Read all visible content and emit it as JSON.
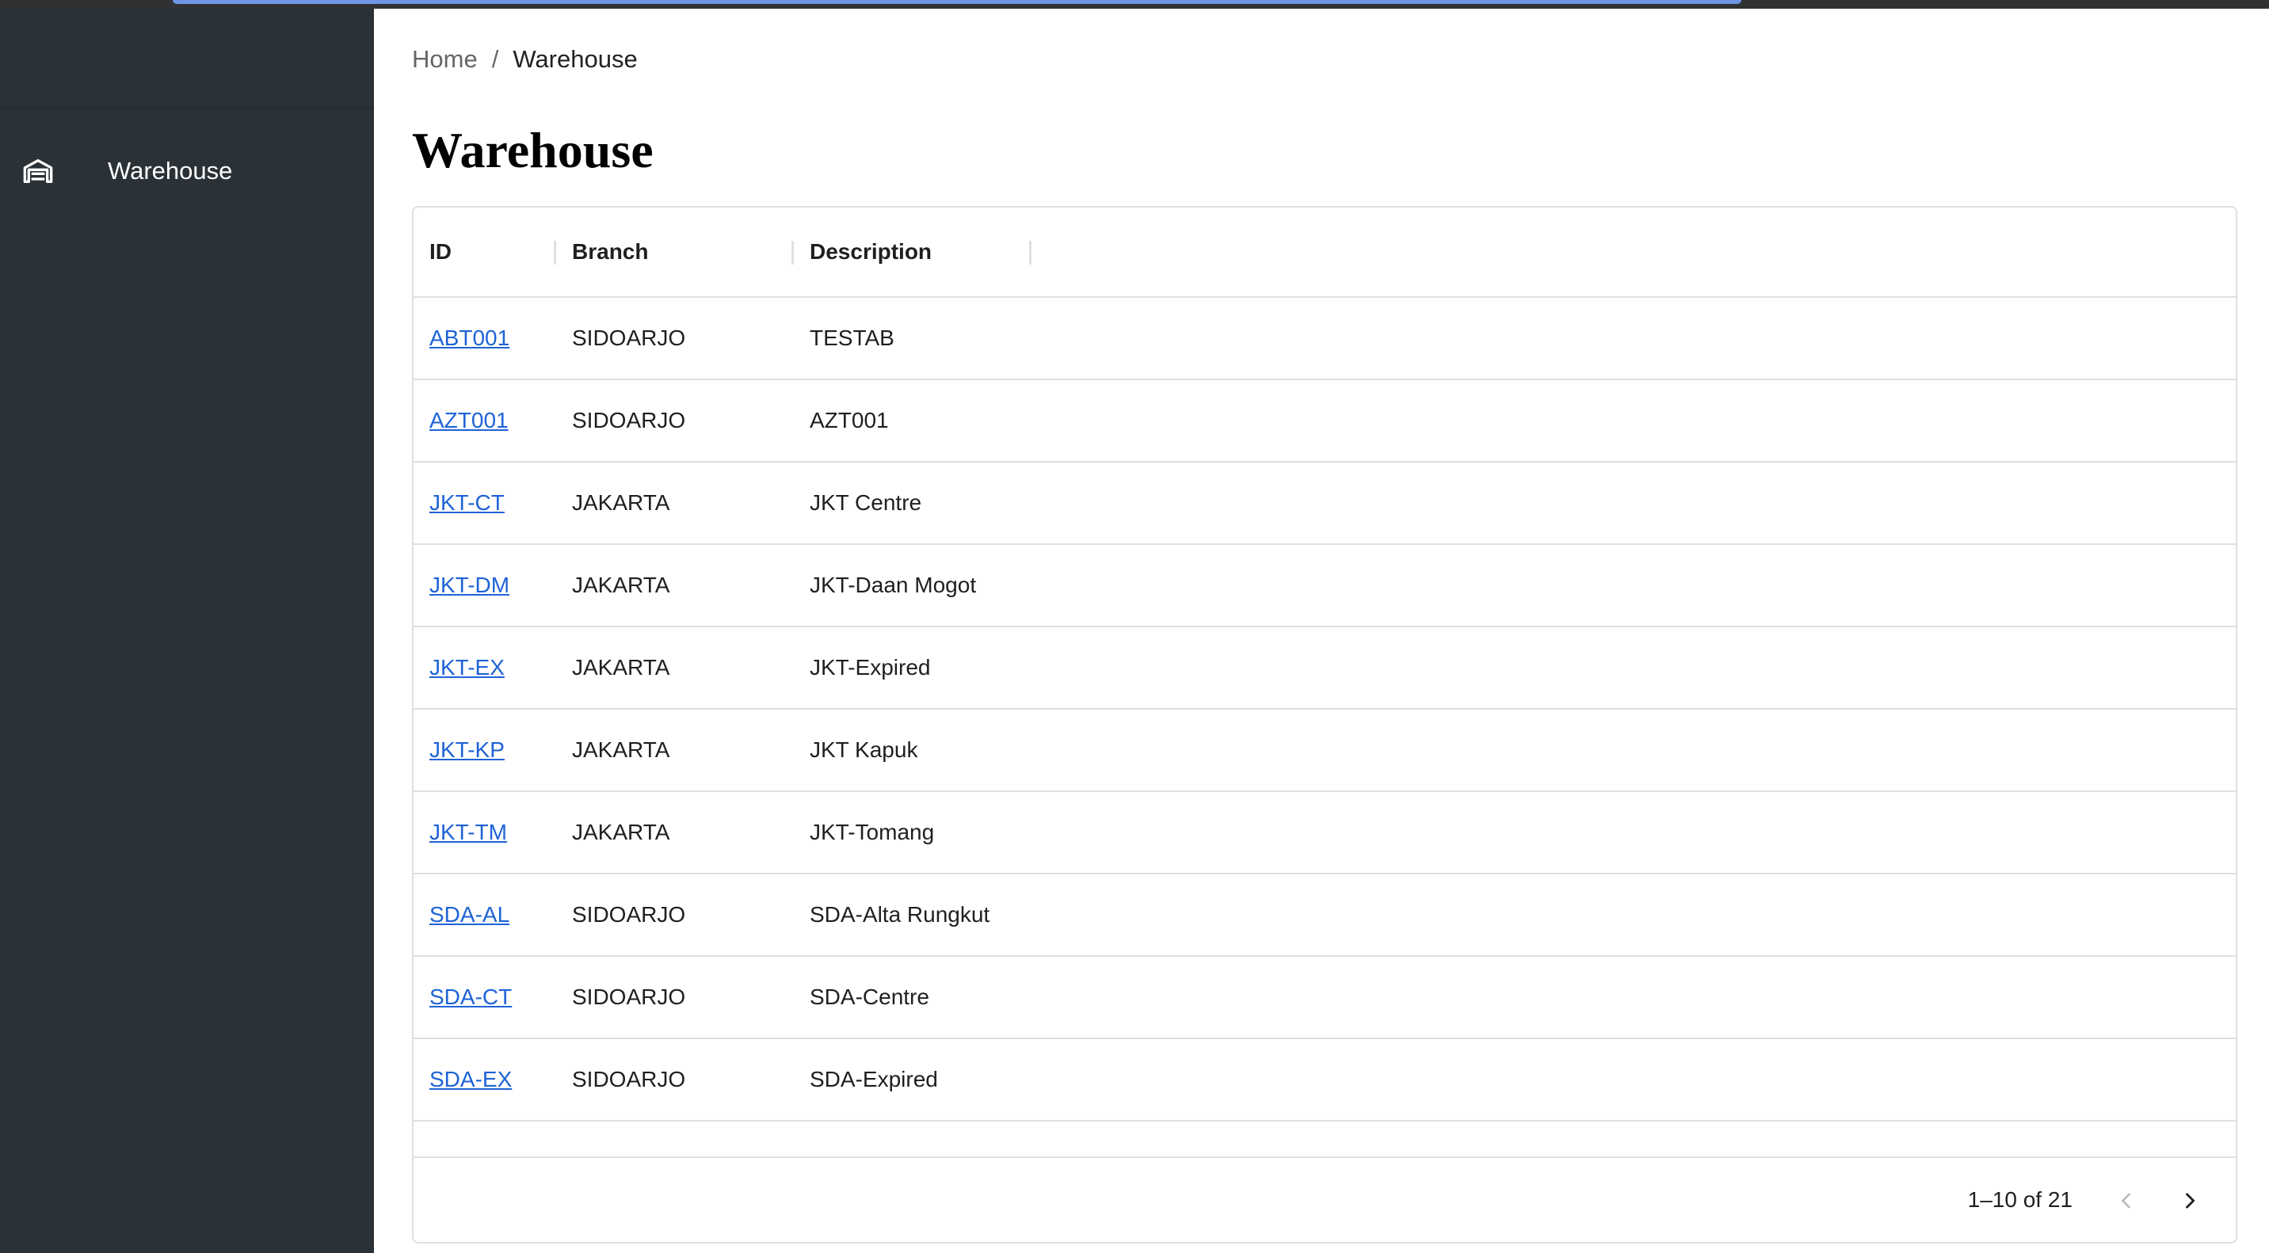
{
  "sidebar": {
    "items": [
      {
        "label": "Warehouse",
        "icon": "warehouse-icon"
      }
    ]
  },
  "breadcrumb": {
    "home": "Home",
    "separator": "/",
    "current": "Warehouse"
  },
  "page": {
    "title": "Warehouse"
  },
  "table": {
    "columns": [
      "ID",
      "Branch",
      "Description"
    ],
    "rows": [
      {
        "id": "ABT001",
        "branch": "SIDOARJO",
        "description": "TESTAB"
      },
      {
        "id": "AZT001",
        "branch": "SIDOARJO",
        "description": "AZT001"
      },
      {
        "id": "JKT-CT",
        "branch": "JAKARTA",
        "description": "JKT Centre"
      },
      {
        "id": "JKT-DM",
        "branch": "JAKARTA",
        "description": "JKT-Daan Mogot"
      },
      {
        "id": "JKT-EX",
        "branch": "JAKARTA",
        "description": "JKT-Expired"
      },
      {
        "id": "JKT-KP",
        "branch": "JAKARTA",
        "description": "JKT Kapuk"
      },
      {
        "id": "JKT-TM",
        "branch": "JAKARTA",
        "description": "JKT-Tomang"
      },
      {
        "id": "SDA-AL",
        "branch": "SIDOARJO",
        "description": "SDA-Alta Rungkut"
      },
      {
        "id": "SDA-CT",
        "branch": "SIDOARJO",
        "description": "SDA-Centre"
      },
      {
        "id": "SDA-EX",
        "branch": "SIDOARJO",
        "description": "SDA-Expired"
      }
    ]
  },
  "pagination": {
    "range_text": "1–10 of 21",
    "prev_icon": "chevron-left-icon",
    "next_icon": "chevron-right-icon"
  },
  "colors": {
    "sidebar_bg": "#2a3137",
    "link": "#1e63d6",
    "border": "#e0e0e0",
    "loading_bar": "#6f95e6"
  }
}
